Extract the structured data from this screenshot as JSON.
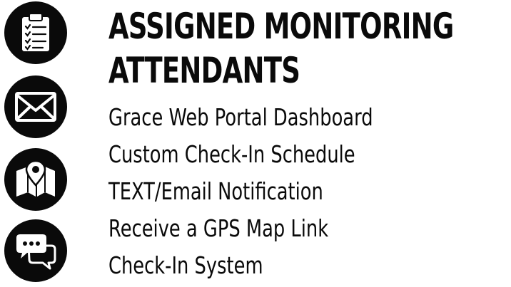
{
  "heading": {
    "line1": "ASSIGNED MONITORING",
    "line2": "ATTENDANTS"
  },
  "icons": [
    {
      "name": "clipboard-checklist-icon"
    },
    {
      "name": "envelope-icon"
    },
    {
      "name": "map-pin-icon"
    },
    {
      "name": "chat-bubbles-icon"
    }
  ],
  "features": [
    "Grace Web Portal Dashboard",
    "Custom Check-In Schedule",
    "TEXT/Email Notification",
    "Receive a GPS Map Link",
    "Check-In System"
  ],
  "colors": {
    "ink": "#0a0a0a",
    "background": "#ffffff"
  }
}
